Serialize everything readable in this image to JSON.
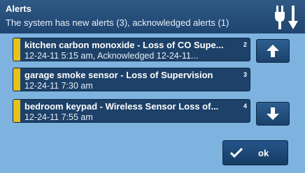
{
  "header": {
    "title": "Alerts",
    "subtitle": "The system has new alerts (3), acknowledged alerts (1)"
  },
  "alerts": [
    {
      "title": "kitchen carbon monoxide - Loss of CO Supe...",
      "detail": "12-24-11 5:15 am, Acknowledged 12-24-11...",
      "number": "2"
    },
    {
      "title": "garage smoke sensor - Loss of Supervision",
      "detail": "12-24-11 7:30 am",
      "number": "3"
    },
    {
      "title": "bedroom keypad  - Wireless Sensor Loss of...",
      "detail": "12-24-11 7:55 am",
      "number": "4"
    }
  ],
  "buttons": {
    "ok_label": "ok",
    "scroll_up_icon": "arrow-up-icon",
    "scroll_down_icon": "arrow-down-icon"
  },
  "icons": {
    "power": "power-plug-icon",
    "check": "checkmark-icon"
  },
  "colors": {
    "background": "#7fb3df",
    "header": "#264d78",
    "row": "#1d4168",
    "stripe": "#e8c21a"
  }
}
